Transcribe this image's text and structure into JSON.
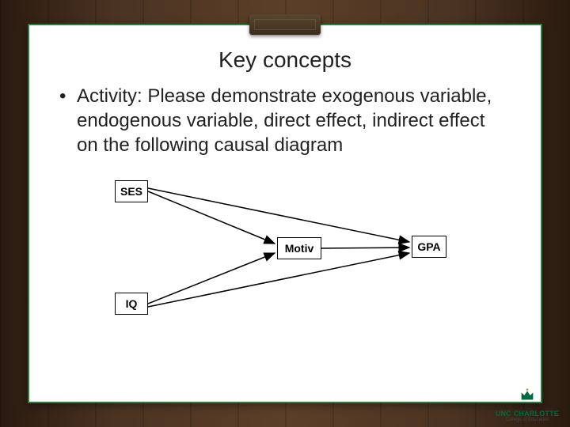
{
  "slide": {
    "title": "Key concepts",
    "bullet_text": "Activity: Please demonstrate exogenous variable, endogenous variable, direct effect, indirect effect on the following causal diagram"
  },
  "diagram": {
    "nodes": {
      "ses": "SES",
      "motiv": "Motiv",
      "gpa": "GPA",
      "iq": "IQ"
    },
    "edges": [
      {
        "from": "SES",
        "to": "Motiv"
      },
      {
        "from": "SES",
        "to": "GPA"
      },
      {
        "from": "IQ",
        "to": "Motiv"
      },
      {
        "from": "IQ",
        "to": "GPA"
      },
      {
        "from": "Motiv",
        "to": "GPA"
      }
    ]
  },
  "branding": {
    "org": "UNC CHARLOTTE",
    "unit": "College of Education"
  },
  "colors": {
    "accent": "#2d7a3e",
    "logo_green": "#006a3f"
  }
}
